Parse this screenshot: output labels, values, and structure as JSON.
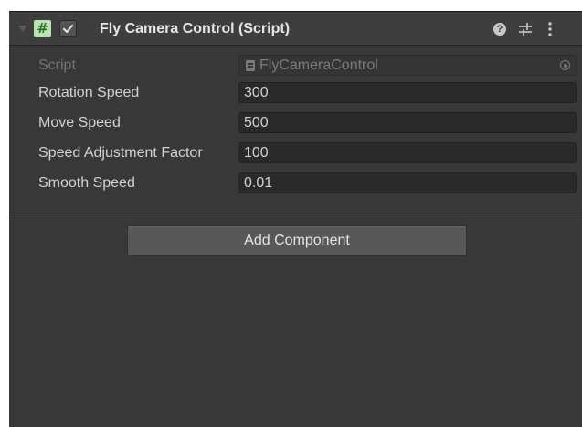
{
  "component": {
    "title": "Fly Camera Control (Script)",
    "enabled": true,
    "icons": {
      "foldout": "foldout-arrow-icon",
      "script": "script-hash-icon",
      "checkbox": "checkmark-icon",
      "help": "help-icon",
      "presets": "presets-sliders-icon",
      "menu": "kebab-menu-icon"
    },
    "help_glyph": "?",
    "script_icon_glyph": "#"
  },
  "properties": {
    "script": {
      "label": "Script",
      "value": "FlyCameraControl"
    },
    "rotation_speed": {
      "label": "Rotation Speed",
      "value": "300"
    },
    "move_speed": {
      "label": "Move Speed",
      "value": "500"
    },
    "speed_adjustment_factor": {
      "label": "Speed Adjustment Factor",
      "value": "100"
    },
    "smooth_speed": {
      "label": "Smooth Speed",
      "value": "0.01"
    }
  },
  "footer": {
    "add_component_label": "Add Component"
  },
  "colors": {
    "panel_background": "#383838",
    "header_background": "#3e3e3e",
    "field_background": "#2a2a2a",
    "button_background": "#585858",
    "script_icon_background": "#b9e3b2"
  }
}
